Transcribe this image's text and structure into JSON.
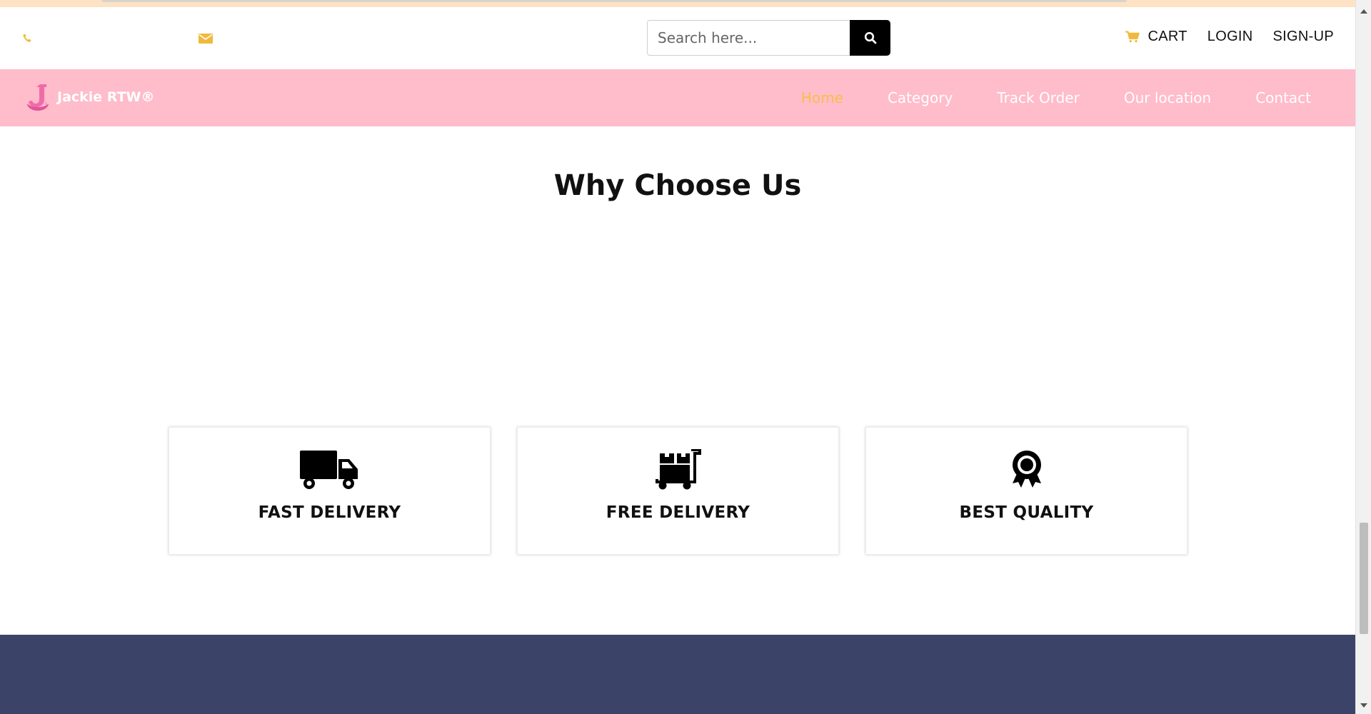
{
  "header": {
    "search": {
      "placeholder": "Search here..."
    },
    "links": {
      "cart": "CART",
      "login": "LOGIN",
      "signup": "SIGN-UP"
    }
  },
  "nav": {
    "brand": "Jackie RTW®",
    "items": [
      {
        "label": "Home",
        "active": true
      },
      {
        "label": "Category",
        "active": false
      },
      {
        "label": "Track Order",
        "active": false
      },
      {
        "label": "Our location",
        "active": false
      },
      {
        "label": "Contact",
        "active": false
      }
    ]
  },
  "main": {
    "title": "Why Choose Us",
    "features": [
      {
        "label": "FAST DELIVERY",
        "icon": "truck-icon"
      },
      {
        "label": "FREE DELIVERY",
        "icon": "dolly-icon"
      },
      {
        "label": "BEST QUALITY",
        "icon": "award-icon"
      }
    ]
  },
  "colors": {
    "nav_bg": "#ffbccb",
    "accent": "#f6be4a",
    "footer_bg": "#3b4468",
    "top_strip": "#fde3c3"
  }
}
